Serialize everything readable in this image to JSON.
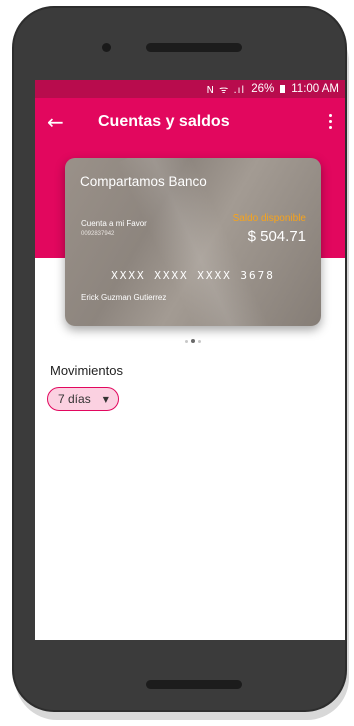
{
  "status_bar": {
    "icons": "N ᯤ .ıl",
    "battery": "26%",
    "time": "11:00 AM"
  },
  "app_bar": {
    "title": "Cuentas y saldos",
    "back_icon": "arrow-left-icon",
    "menu_icon": "more-vert-icon"
  },
  "card": {
    "bank_name": "Compartamos Banco",
    "account_label": "Cuenta a mi Favor",
    "account_number": "0092837942",
    "balance_label": "Saldo disponible",
    "balance_value": "$ 504.71",
    "card_number": "XXXX XXXX XXXX 3678",
    "holder_name": "Erick Guzman Gutierrez"
  },
  "pager": {
    "count": 3,
    "active": 1
  },
  "movements": {
    "title": "Movimientos",
    "filter_value": "7 días"
  },
  "colors": {
    "primary": "#e2075e",
    "status_bar": "#b80c4d",
    "balance_label": "#f7a31b",
    "chip_bg": "#fbd1e1"
  }
}
